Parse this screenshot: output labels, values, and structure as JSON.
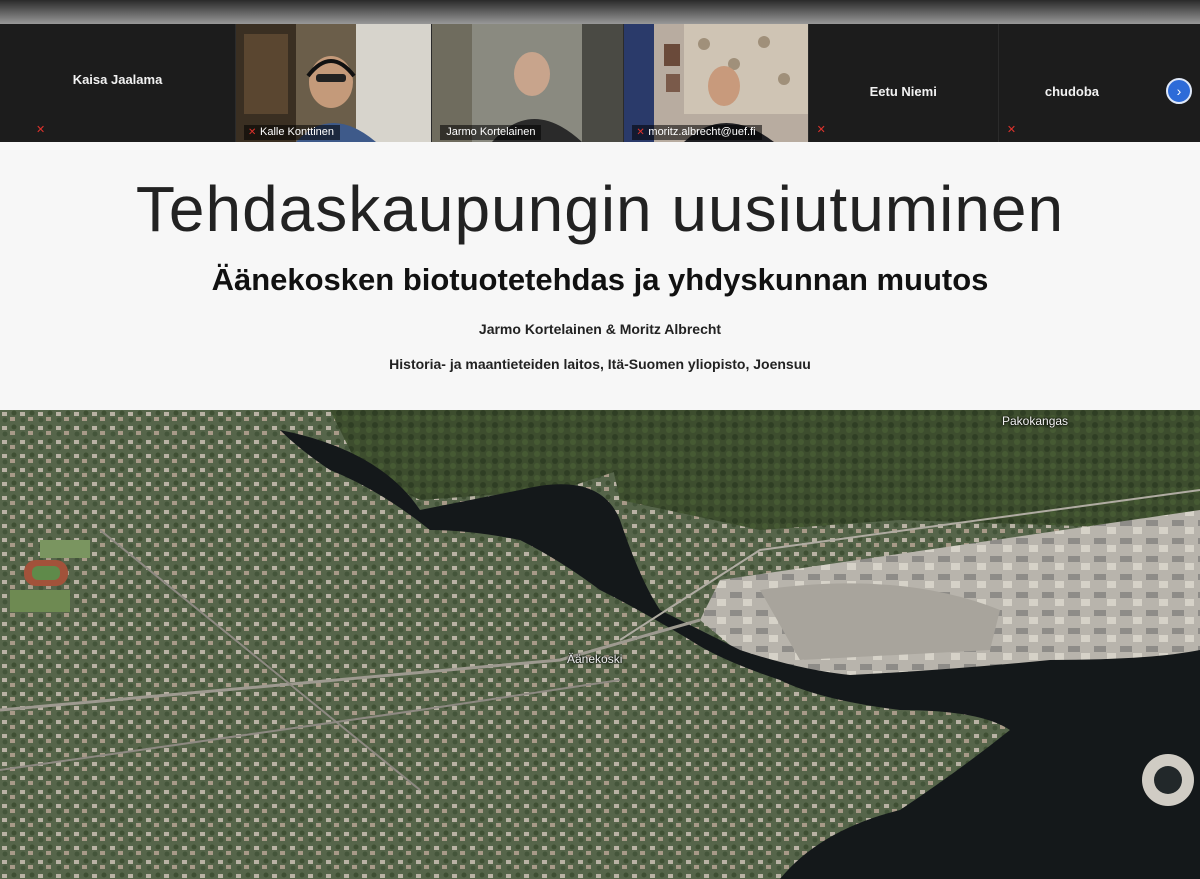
{
  "participants": [
    {
      "name": "Kaisa Jaalama",
      "video": false,
      "muted": true
    },
    {
      "name": "Kalle Konttinen",
      "video": true,
      "muted": true
    },
    {
      "name": "Jarmo Kortelainen",
      "video": true,
      "muted": false
    },
    {
      "name": "moritz.albrecht@uef.fi",
      "video": true,
      "muted": true
    },
    {
      "name": "Eetu Niemi",
      "video": false,
      "muted": true
    },
    {
      "name": "chudoba",
      "video": false,
      "muted": true
    }
  ],
  "gallery": {
    "next_icon": "chevron-right-icon",
    "next_glyph": "›"
  },
  "slide": {
    "title": "Tehdaskaupungin uusiutuminen",
    "subtitle": "Äänekosken biotuotetehdas ja yhdyskunnan muutos",
    "authors": "Jarmo Kortelainen & Moritz Albrecht",
    "affiliation": "Historia- ja maantieteiden laitos, Itä-Suomen yliopisto, Joensuu"
  },
  "map": {
    "labels": {
      "town": "Äänekoski",
      "district": "Pakokangas"
    }
  },
  "colors": {
    "mute": "#e0322c",
    "accent": "#2d6bd8"
  }
}
